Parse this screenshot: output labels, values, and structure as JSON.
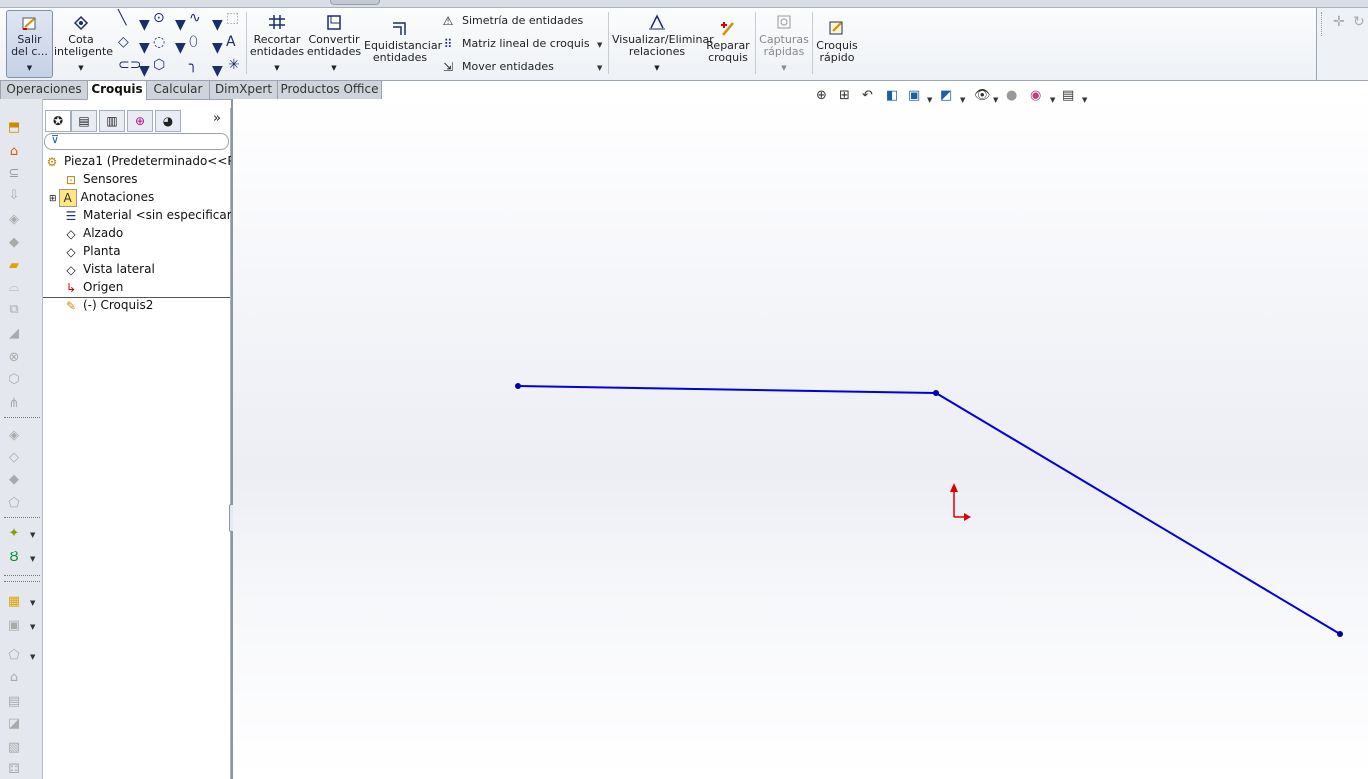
{
  "ribbon": {
    "exit_sketch": {
      "line1": "Salir",
      "line2": "del c..."
    },
    "smart_dim": {
      "line1": "Cota",
      "line2": "inteligente"
    },
    "trim": {
      "line1": "Recortar",
      "line2": "entidades"
    },
    "convert": {
      "line1": "Convertir",
      "line2": "entidades"
    },
    "offset": {
      "line1": "Equidistanciar",
      "line2": "entidades"
    },
    "mirror": "Simetría de entidades",
    "linear_pattern": "Matriz lineal de croquis",
    "move": "Mover entidades",
    "relations": {
      "line1": "Visualizar/Eliminar",
      "line2": "relaciones"
    },
    "repair": {
      "line1": "Reparar",
      "line2": "croquis"
    },
    "snaps": {
      "line1": "Capturas",
      "line2": "rápidas"
    },
    "quick_sketch": {
      "line1": "Croquis",
      "line2": "rápido"
    }
  },
  "tabs": [
    {
      "label": "Operaciones",
      "active": false
    },
    {
      "label": "Croquis",
      "active": true
    },
    {
      "label": "Calcular",
      "active": false
    },
    {
      "label": "DimXpert",
      "active": false
    },
    {
      "label": "Productos Office",
      "active": false
    }
  ],
  "feature_tree": {
    "root": "Pieza1  (Predeterminado<<Pred",
    "items": [
      "Sensores",
      "Anotaciones",
      "Material <sin especificar>",
      "Alzado",
      "Planta",
      "Vista lateral",
      "Origen"
    ],
    "sketch": "(-) Croquis2"
  },
  "sketch_geometry": {
    "description_color": "#0000dd",
    "origin_color": "#dd0000"
  },
  "icons": {
    "collapse": "»"
  }
}
